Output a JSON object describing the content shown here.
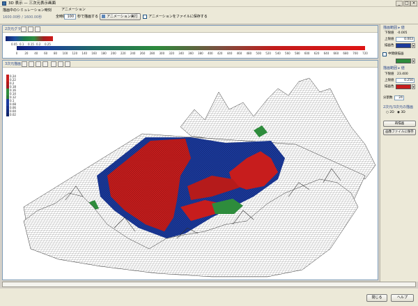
{
  "window": {
    "title": "3D 表示 — 三次元表示画面"
  },
  "topbar": {
    "group_label": "描画中のシミュレーション時刻",
    "time_values": "1600.00秒 / 1600.00秒",
    "anim_label": "アニメーション",
    "interval_prefix": "全時間",
    "interval_value": "100",
    "interval_suffix": "秒で描画する",
    "anim_button": "アニメーション実行",
    "save_anim_label": "アニメーションをファイルに保存する"
  },
  "colorbar_panel": {
    "title": "2次元グラフ",
    "small_ticks": [
      "0.05",
      "0.1",
      "0.15",
      "0.2",
      "0.25"
    ],
    "big_ticks": [
      "0",
      "20",
      "40",
      "60",
      "80",
      "100",
      "120",
      "140",
      "160",
      "180",
      "200",
      "220",
      "240",
      "260",
      "280",
      "300",
      "320",
      "340",
      "360",
      "380",
      "400",
      "420",
      "440",
      "460",
      "480",
      "500",
      "520",
      "540",
      "560",
      "580",
      "600",
      "620",
      "640",
      "660",
      "680",
      "700",
      "720"
    ]
  },
  "view_panel": {
    "title": "3次元描画",
    "legend_values": [
      "0.24",
      "0.22",
      "0.2",
      "0.18",
      "0.16",
      "0.14",
      "0.12",
      "0.1",
      "0.08",
      "0.06",
      "0.04",
      "0.02"
    ]
  },
  "right_panel": {
    "range_title": "描画範囲 ▸ 値",
    "lower_label": "下限値",
    "lower_value": "-0.005",
    "upper_label": "上限値",
    "upper_value": "0.003",
    "color_label": "描画色",
    "mid_check_label": "中間値描画",
    "range2_title": "描画範囲 ▸ 値",
    "lower2_label": "下限値",
    "lower2_value": "23.400",
    "upper2_label": "上限値",
    "upper2_value": "0.250",
    "color2_label": "描画色",
    "step_label": "分割数",
    "step_value": "24",
    "dim_title": "2次元/3次元の描画",
    "radio_2d": "2D",
    "radio_3d": "3D",
    "redraw_button": "再描画",
    "image_button": "画像ファイルに保存"
  },
  "footer": {
    "close_button": "閉じる",
    "help_button": "ヘルプ"
  },
  "colors": {
    "blue": "#1b3a9c",
    "green": "#2e8c3c",
    "red": "#c71d1d",
    "mesh": "#4a4a4a"
  }
}
